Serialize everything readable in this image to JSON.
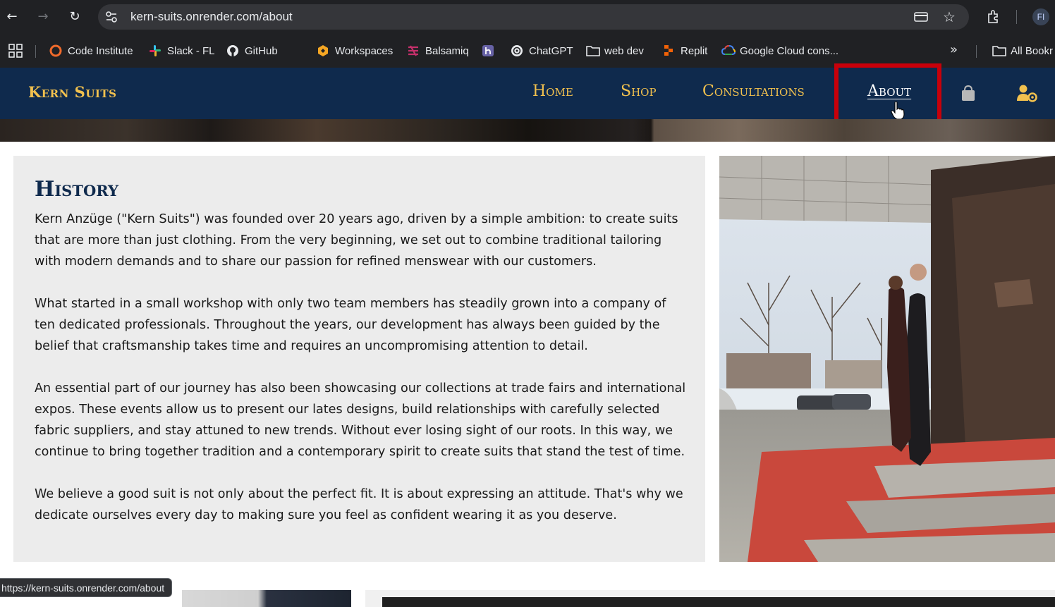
{
  "browser": {
    "url": "kern-suits.onrender.com/about",
    "profile_initials": "FI",
    "bookmarks": [
      {
        "label": "Code Institute",
        "icon": "code-institute-icon"
      },
      {
        "label": "Slack - FL",
        "icon": "slack-icon"
      },
      {
        "label": "GitHub",
        "icon": "github-icon"
      },
      {
        "label": "Workspaces",
        "icon": "workspaces-icon"
      },
      {
        "label": "Balsamiq",
        "icon": "balsamiq-icon"
      },
      {
        "label": "",
        "icon": "heroku-icon"
      },
      {
        "label": "ChatGPT",
        "icon": "chatgpt-icon"
      },
      {
        "label": "web dev",
        "icon": "folder-icon"
      },
      {
        "label": "Replit",
        "icon": "replit-icon"
      },
      {
        "label": "Google Cloud cons...",
        "icon": "google-cloud-icon"
      },
      {
        "label": "All Bookr",
        "icon": "folder-icon"
      }
    ],
    "status_url": "https://kern-suits.onrender.com/about"
  },
  "site": {
    "brand": "Kern Suits",
    "nav": [
      {
        "label": "Home",
        "active": false
      },
      {
        "label": "Shop",
        "active": false
      },
      {
        "label": "Consultations",
        "active": false
      },
      {
        "label": "About",
        "active": true
      }
    ],
    "icons": [
      "shopping-bag-icon",
      "user-cog-icon"
    ],
    "colors": {
      "navy": "#0f2a4d",
      "gold": "#f2c14e",
      "highlight": "#c8000a",
      "card": "#ececec"
    }
  },
  "history": {
    "title": "History",
    "paragraphs": [
      "Kern Anzüge (\"Kern Suits\") was founded over 20 years ago, driven by a simple ambition: to create suits that are more than just clothing. From the very beginning, we set out to combine traditional tailoring with modern demands and to share our passion for refined menswear with our customers.",
      "What started in a small workshop with only two team members has steadily grown into a company of ten dedicated professionals. Throughout the years, our development has always been guided by the belief that craftsmanship takes time and requires an uncompromising attention to detail.",
      "An essential part of our journey has also been showcasing our collections at trade fairs and international expos. These events allow us to present our lates designs, build relationships with carefully selected fabric suppliers, and stay attuned to new trends. Without ever losing sight of our roots. In this way, we continue to bring together tradition and a contemporary spirit to create suits that stand the test of time.",
      "We believe a good suit is not only about the perfect fit. It is about expressing an attitude. That's why we dedicate ourselves every day to making sure you feel as confident wearing it as you deserve."
    ]
  }
}
